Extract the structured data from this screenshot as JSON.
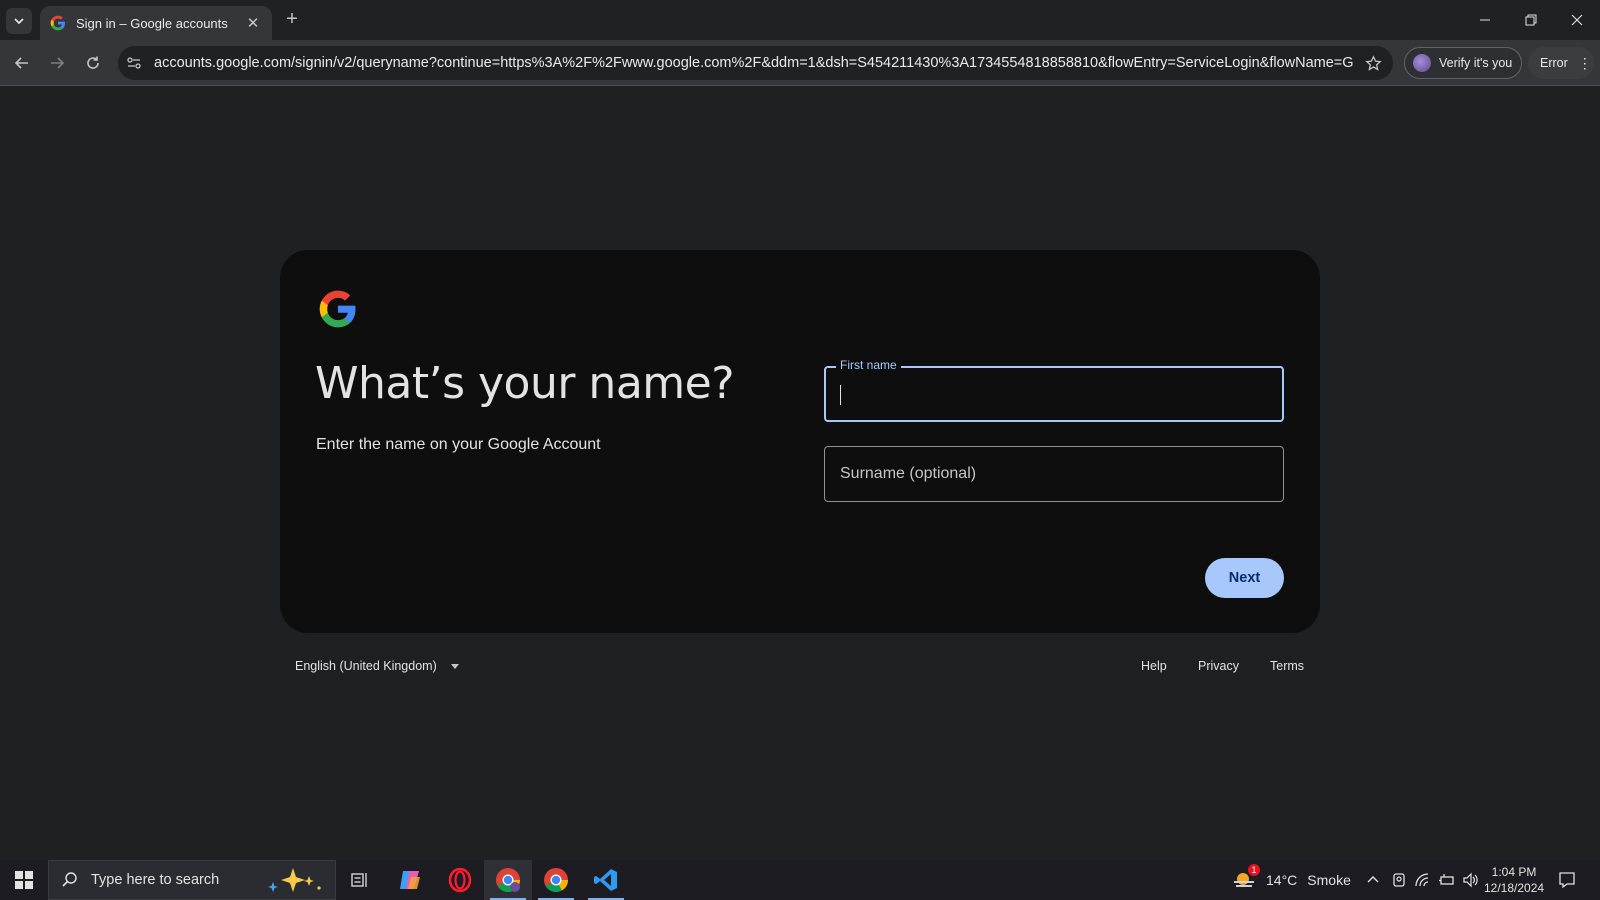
{
  "browser": {
    "tab_title": "Sign in – Google accounts",
    "url": "accounts.google.com/signin/v2/queryname?continue=https%3A%2F%2Fwww.google.com%2F&ddm=1&dsh=S454211430%3A1734554818858810&flowEntry=ServiceLogin&flowName=GlifW...",
    "verify_label": "Verify it's you",
    "error_label": "Error"
  },
  "page": {
    "heading": "What’s your name?",
    "subtext": "Enter the name on your Google Account",
    "first_name_label": "First name",
    "first_name_value": "",
    "surname_placeholder": "Surname (optional)",
    "next_label": "Next"
  },
  "footer": {
    "language": "English (United Kingdom)",
    "help": "Help",
    "privacy": "Privacy",
    "terms": "Terms"
  },
  "taskbar": {
    "search_placeholder": "Type here to search",
    "weather_temp": "14°C",
    "weather_desc": "Smoke",
    "weather_badge": "1",
    "time": "1:04 PM",
    "date": "12/18/2024"
  },
  "colors": {
    "accent": "#a8c7fa",
    "card_bg": "#0e0e0e",
    "page_bg": "#1f2022"
  }
}
